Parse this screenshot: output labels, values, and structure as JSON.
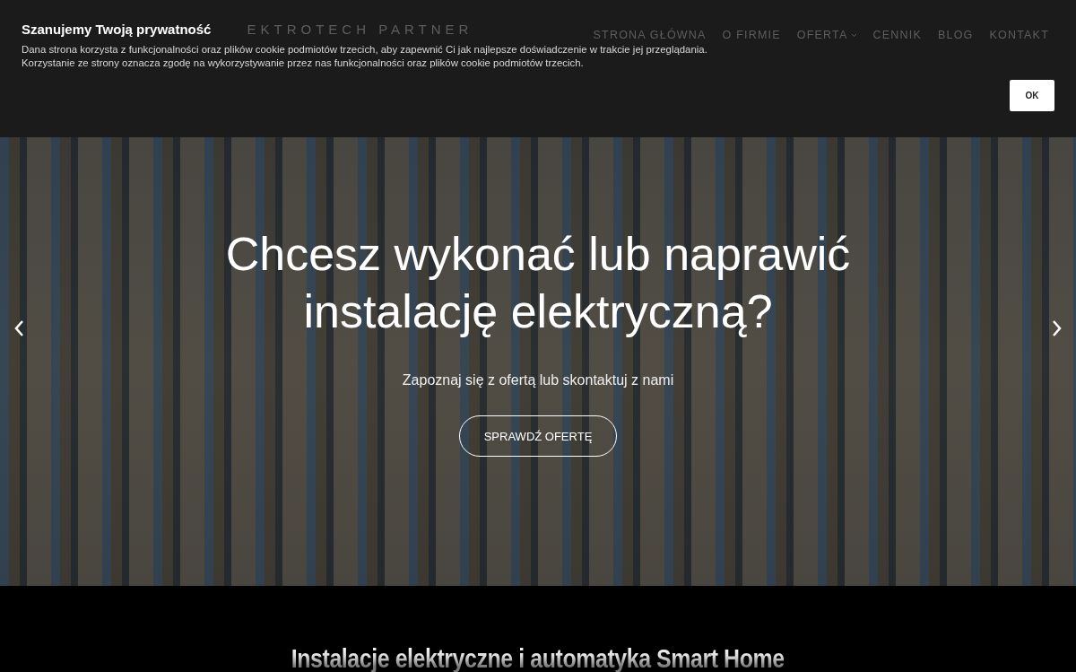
{
  "cookie_banner": {
    "title": "Szanujemy Twoją prywatność",
    "text": "Dana strona korzysta z funkcjonalności oraz plików cookie podmiotów trzecich, aby zapewnić Ci jak najlepsze doświadczenie w trakcie jej przeglądania. Korzystanie ze strony oznacza zgodę na wykorzystywanie przez nas funkcjonalności oraz plików cookie podmiotów trzecich.",
    "button": "OK"
  },
  "header": {
    "logo_text": "EKTROTECH PARTNER",
    "nav": [
      {
        "label": "STRONA GŁÓWNA",
        "dropdown": false
      },
      {
        "label": "O FIRMIE",
        "dropdown": false
      },
      {
        "label": "OFERTA",
        "dropdown": true
      },
      {
        "label": "CENNIK",
        "dropdown": false
      },
      {
        "label": "BLOG",
        "dropdown": false
      },
      {
        "label": "KONTAKT",
        "dropdown": false
      }
    ]
  },
  "hero": {
    "headline": "Chcesz wykonać lub naprawić instalację elektryczną?",
    "subtitle": "Zapoznaj się z ofertą lub skontaktuj z nami",
    "button": "SPRAWDŹ OFERTĘ"
  },
  "section": {
    "heading": "Instalacje elektryczne i automatyka Smart Home"
  }
}
